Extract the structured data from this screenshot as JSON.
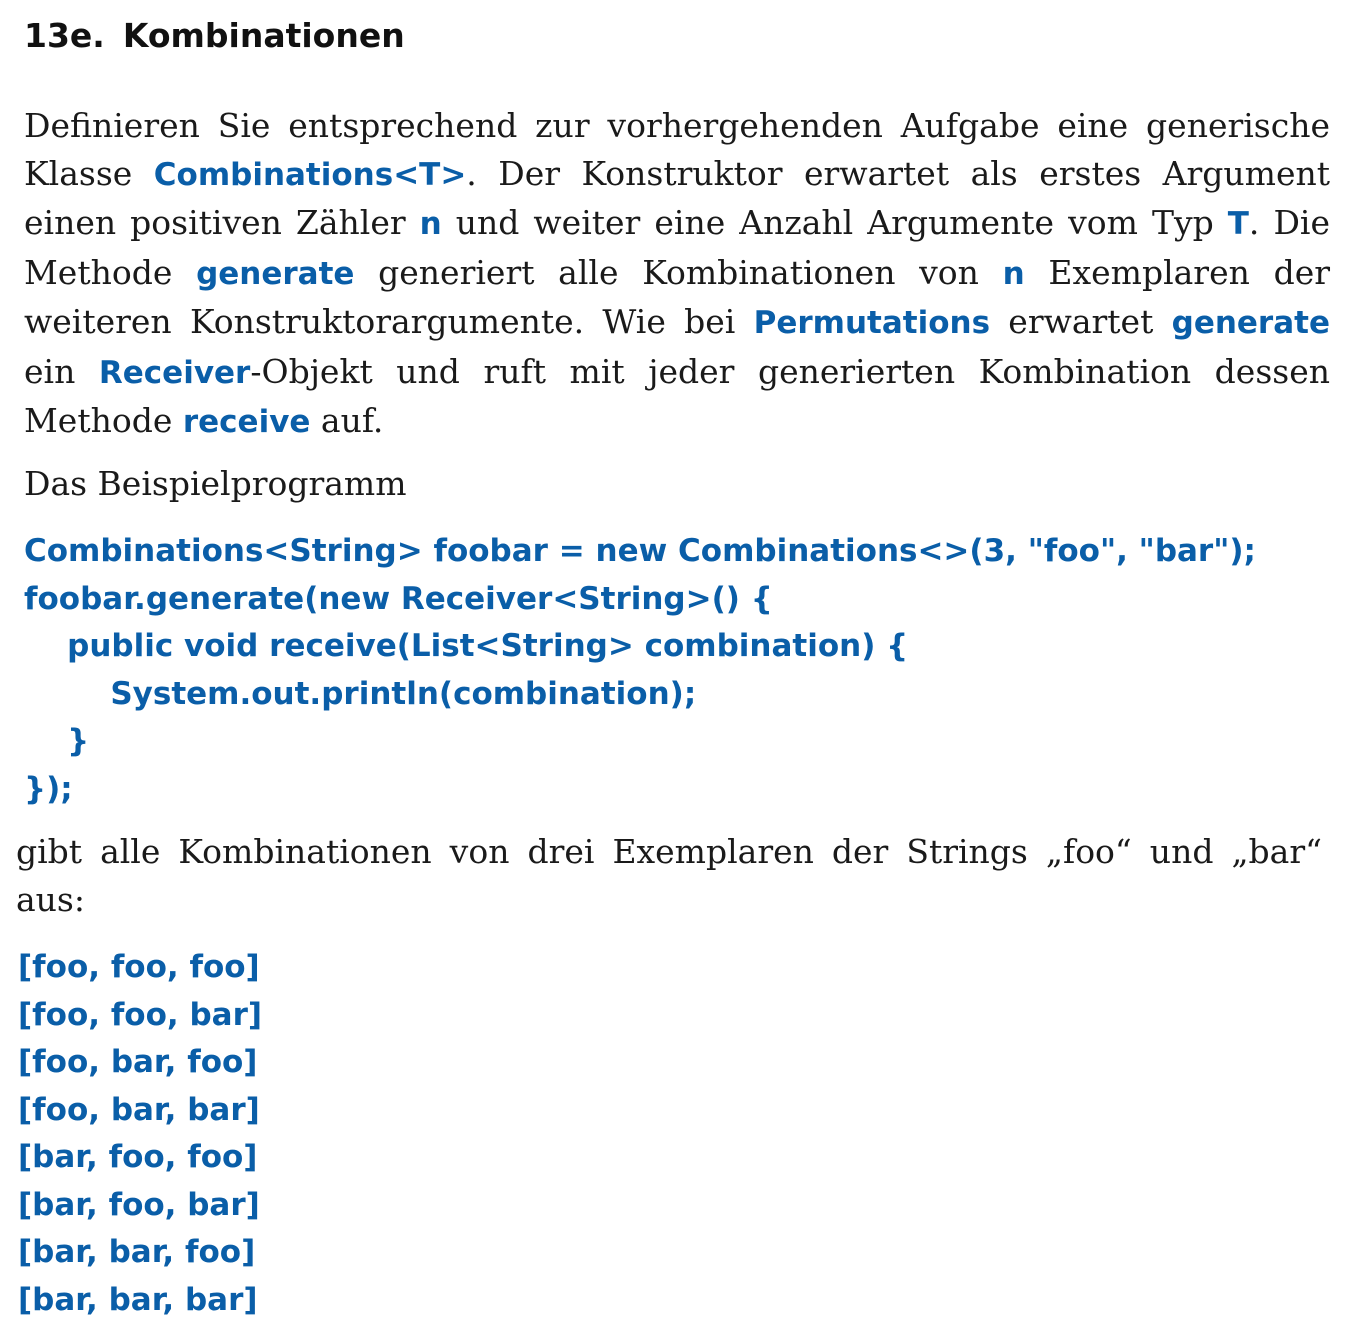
{
  "heading": {
    "number": "13e.",
    "title": "Kombinationen"
  },
  "paragraph1": {
    "t1": "Definieren Sie entsprechend zur vorhergehenden Aufgabe eine generische Klasse ",
    "k1": "Combinations<T>",
    "t2": ". Der Konstruktor erwartet als erstes Argument einen positiven Zähler ",
    "k2": "n",
    "t3": " und weiter eine Anzahl Argumente vom Typ ",
    "k3": "T",
    "t4": ". Die Methode ",
    "k4": "generate",
    "t5": " generiert alle Kombinationen von ",
    "k5": "n",
    "t6": " Exemplaren der weiteren Konstruktorargumente. Wie bei ",
    "k6": "Permutations",
    "t7": " erwartet ",
    "k7": "generate",
    "t8": " ein ",
    "k8": "Receiver",
    "t9": "-Objekt und ruft mit jeder generierten Kombination dessen Methode ",
    "k9": "receive",
    "t10": " auf."
  },
  "paragraph2": "Das Beispielprogramm",
  "code_lines": [
    "Combinations<String> foobar = new Combinations<>(3, \"foo\", \"bar\");",
    "foobar.generate(new Receiver<String>() {",
    "    public void receive(List<String> combination) {",
    "        System.out.println(combination);",
    "    }",
    "});"
  ],
  "paragraph3": "gibt alle Kombinationen von drei Exemplaren der Strings „foo“ und „bar“ aus:",
  "output_lines": [
    "[foo, foo, foo]",
    "[foo, foo, bar]",
    "[foo, bar, foo]",
    "[foo, bar, bar]",
    "[bar, foo, foo]",
    "[bar, foo, bar]",
    "[bar, bar, foo]",
    "[bar, bar, bar]"
  ],
  "colors": {
    "code_blue": "#0a5ea8",
    "text": "#1a1a1a"
  }
}
